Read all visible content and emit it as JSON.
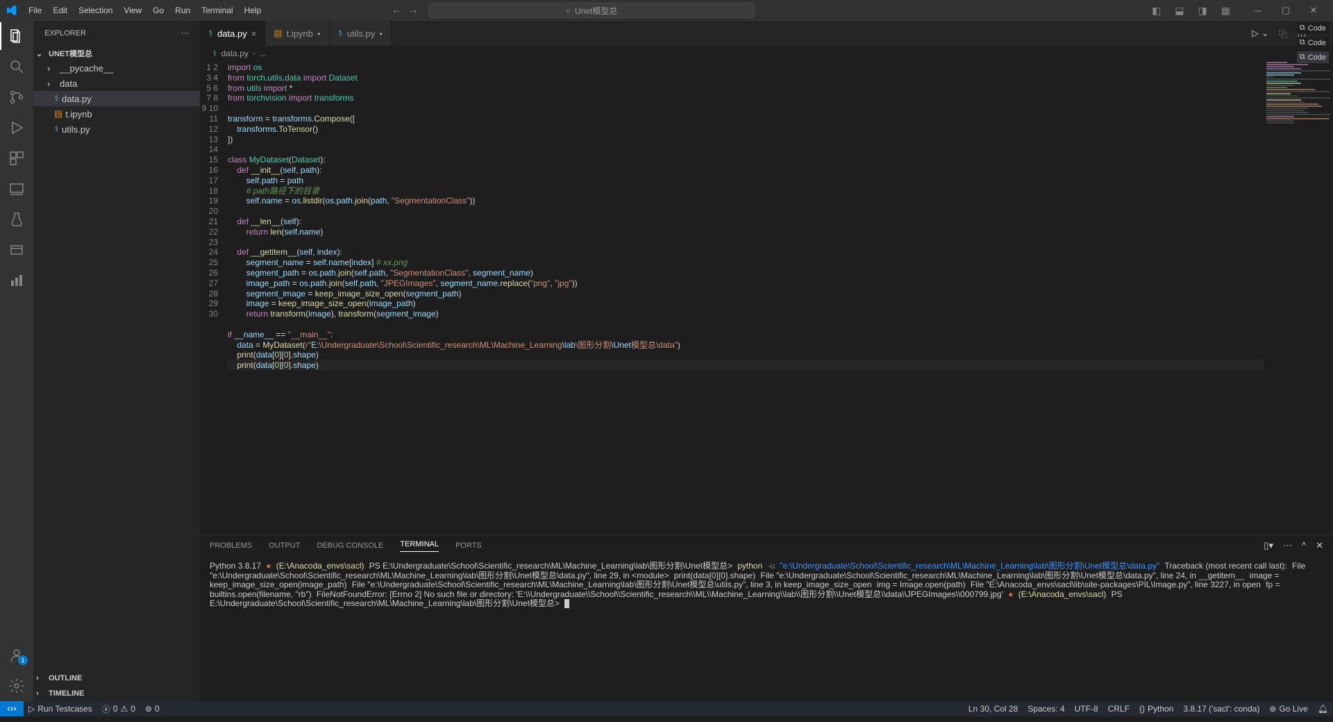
{
  "menu": [
    "File",
    "Edit",
    "Selection",
    "View",
    "Go",
    "Run",
    "Terminal",
    "Help"
  ],
  "search_placeholder": "Unet模型总",
  "explorer": {
    "title": "EXPLORER",
    "project": "UNET模型总",
    "tree": [
      {
        "type": "folder",
        "name": "__pycache__"
      },
      {
        "type": "folder",
        "name": "data"
      },
      {
        "type": "file",
        "name": "data.py",
        "selected": true,
        "icon": "py"
      },
      {
        "type": "file",
        "name": "t.ipynb",
        "icon": "nb"
      },
      {
        "type": "file",
        "name": "utils.py",
        "icon": "py"
      }
    ],
    "outline": "OUTLINE",
    "timeline": "TIMELINE"
  },
  "tabs": [
    {
      "name": "data.py",
      "icon": "py",
      "active": true,
      "dirty": false
    },
    {
      "name": "t.ipynb",
      "icon": "nb",
      "active": false,
      "dirty": true
    },
    {
      "name": "utils.py",
      "icon": "py",
      "active": false,
      "dirty": true
    }
  ],
  "breadcrumb": [
    "data.py",
    "..."
  ],
  "panel_tabs": [
    "PROBLEMS",
    "OUTPUT",
    "DEBUG CONSOLE",
    "TERMINAL",
    "PORTS"
  ],
  "panel_active": "TERMINAL",
  "terminal": {
    "ver": "Python 3.8.17",
    "env": "(E:\\Anacoda_envs\\sacl)",
    "ps": "PS E:\\Undergraduate\\School\\Scientific_research\\ML\\Machine_Learning\\lab\\图形分割\\Unet模型总>",
    "cmd": "python",
    "arg": "-u",
    "file": "\"e:\\Undergraduate\\School\\Scientific_research\\ML\\Machine_Learning\\lab\\图形分割\\Unet模型总\\data.py\"",
    "tb": "Traceback (most recent call last):",
    "l1a": "  File \"e:\\Undergraduate\\School\\Scientific_research\\ML\\Machine_Learning\\lab\\图形分割\\Unet模型总\\data.py\", line 29, in <module>",
    "l1b": "    print(data[0][0].shape)",
    "l2a": "  File \"e:\\Undergraduate\\School\\Scientific_research\\ML\\Machine_Learning\\lab\\图形分割\\Unet模型总\\data.py\", line 24, in __getitem__",
    "l2b": "    image = keep_image_size_open(image_path)",
    "l3a": "  File \"e:\\Undergraduate\\School\\Scientific_research\\ML\\Machine_Learning\\lab\\图形分割\\Unet模型总\\utils.py\", line 3, in keep_image_size_open",
    "l3b": "    img = Image.open(path)",
    "l4a": "  File \"E:\\Anacoda_envs\\sacl\\lib\\site-packages\\PIL\\Image.py\", line 3227, in open",
    "l4b": "    fp = builtins.open(filename, \"rb\")",
    "err": "FileNotFoundError: [Errno 2] No such file or directory: 'E:\\\\Undergraduate\\\\School\\\\Scientific_research\\\\ML\\\\Machine_Learning\\\\lab\\\\图形分割\\\\Unet模型总\\\\data\\\\JPEGImages\\\\000799.jpg'"
  },
  "term_tabs": [
    "Code",
    "Code",
    "Code"
  ],
  "status": {
    "run": "Run Testcases",
    "err": "0",
    "warn": "0",
    "ports": "0",
    "pos": "Ln 30, Col 28",
    "spaces": "Spaces: 4",
    "enc": "UTF-8",
    "eol": "CRLF",
    "lang": "Python",
    "interp": "3.8.17 ('sacl': conda)",
    "live": "Go Live"
  }
}
